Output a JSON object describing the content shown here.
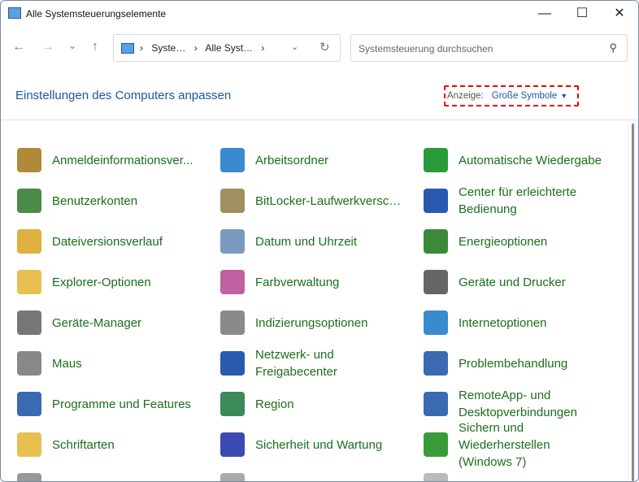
{
  "window": {
    "title": "Alle Systemsteuerungselemente",
    "minimize": "—",
    "maximize": "☐",
    "close": "✕"
  },
  "nav": {
    "back": "←",
    "forward": "→",
    "recent": "⌄",
    "up": "↑"
  },
  "address": {
    "crumbs": [
      "›",
      "Syste…",
      "›",
      "Alle Syst…",
      "›"
    ],
    "dropdown": "⌄",
    "refresh": "↻"
  },
  "search": {
    "placeholder": "Systemsteuerung durchsuchen",
    "icon": "⚲"
  },
  "heading": "Einstellungen des Computers anpassen",
  "view": {
    "label": "Anzeige:",
    "value": "Große Symbole",
    "arrow": "▼"
  },
  "items": [
    {
      "label": "Anmeldeinformationsver...",
      "color": "#b08a3a"
    },
    {
      "label": "Arbeitsordner",
      "color": "#3a8ad0"
    },
    {
      "label": "Automatische Wiedergabe",
      "color": "#2a9a3a"
    },
    {
      "label": "Benutzerkonten",
      "color": "#4a8a4a"
    },
    {
      "label": "BitLocker-Laufwerkversch...",
      "color": "#a09060"
    },
    {
      "label": "Center für erleichterte Bedienung",
      "color": "#2a5ab0"
    },
    {
      "label": "Dateiversionsverlauf",
      "color": "#e0b040"
    },
    {
      "label": "Datum und Uhrzeit",
      "color": "#7a9ac0"
    },
    {
      "label": "Energieoptionen",
      "color": "#3a8a3a"
    },
    {
      "label": "Explorer-Optionen",
      "color": "#e8c050"
    },
    {
      "label": "Farbverwaltung",
      "color": "#c060a0"
    },
    {
      "label": "Geräte und Drucker",
      "color": "#666666"
    },
    {
      "label": "Geräte-Manager",
      "color": "#777777"
    },
    {
      "label": "Indizierungsoptionen",
      "color": "#8a8a8a"
    },
    {
      "label": "Internetoptionen",
      "color": "#3a8ad0"
    },
    {
      "label": "Maus",
      "color": "#888888"
    },
    {
      "label": "Netzwerk- und Freigabecenter",
      "color": "#2a5ab0"
    },
    {
      "label": "Problembehandlung",
      "color": "#3a6ab0"
    },
    {
      "label": "Programme und Features",
      "color": "#3a6ab0"
    },
    {
      "label": "Region",
      "color": "#3a8a5a"
    },
    {
      "label": "RemoteApp- und Desktopverbindungen",
      "color": "#3a6ab0"
    },
    {
      "label": "Schriftarten",
      "color": "#e8c050"
    },
    {
      "label": "Sicherheit und Wartung",
      "color": "#3a4ab0"
    },
    {
      "label": "Sichern und Wiederherstellen (Windows 7)",
      "color": "#3a9a3a"
    },
    {
      "label": "",
      "color": "#999999"
    },
    {
      "label": "",
      "color": "#aaaaaa"
    },
    {
      "label": "",
      "color": "#bbbbbb"
    }
  ]
}
